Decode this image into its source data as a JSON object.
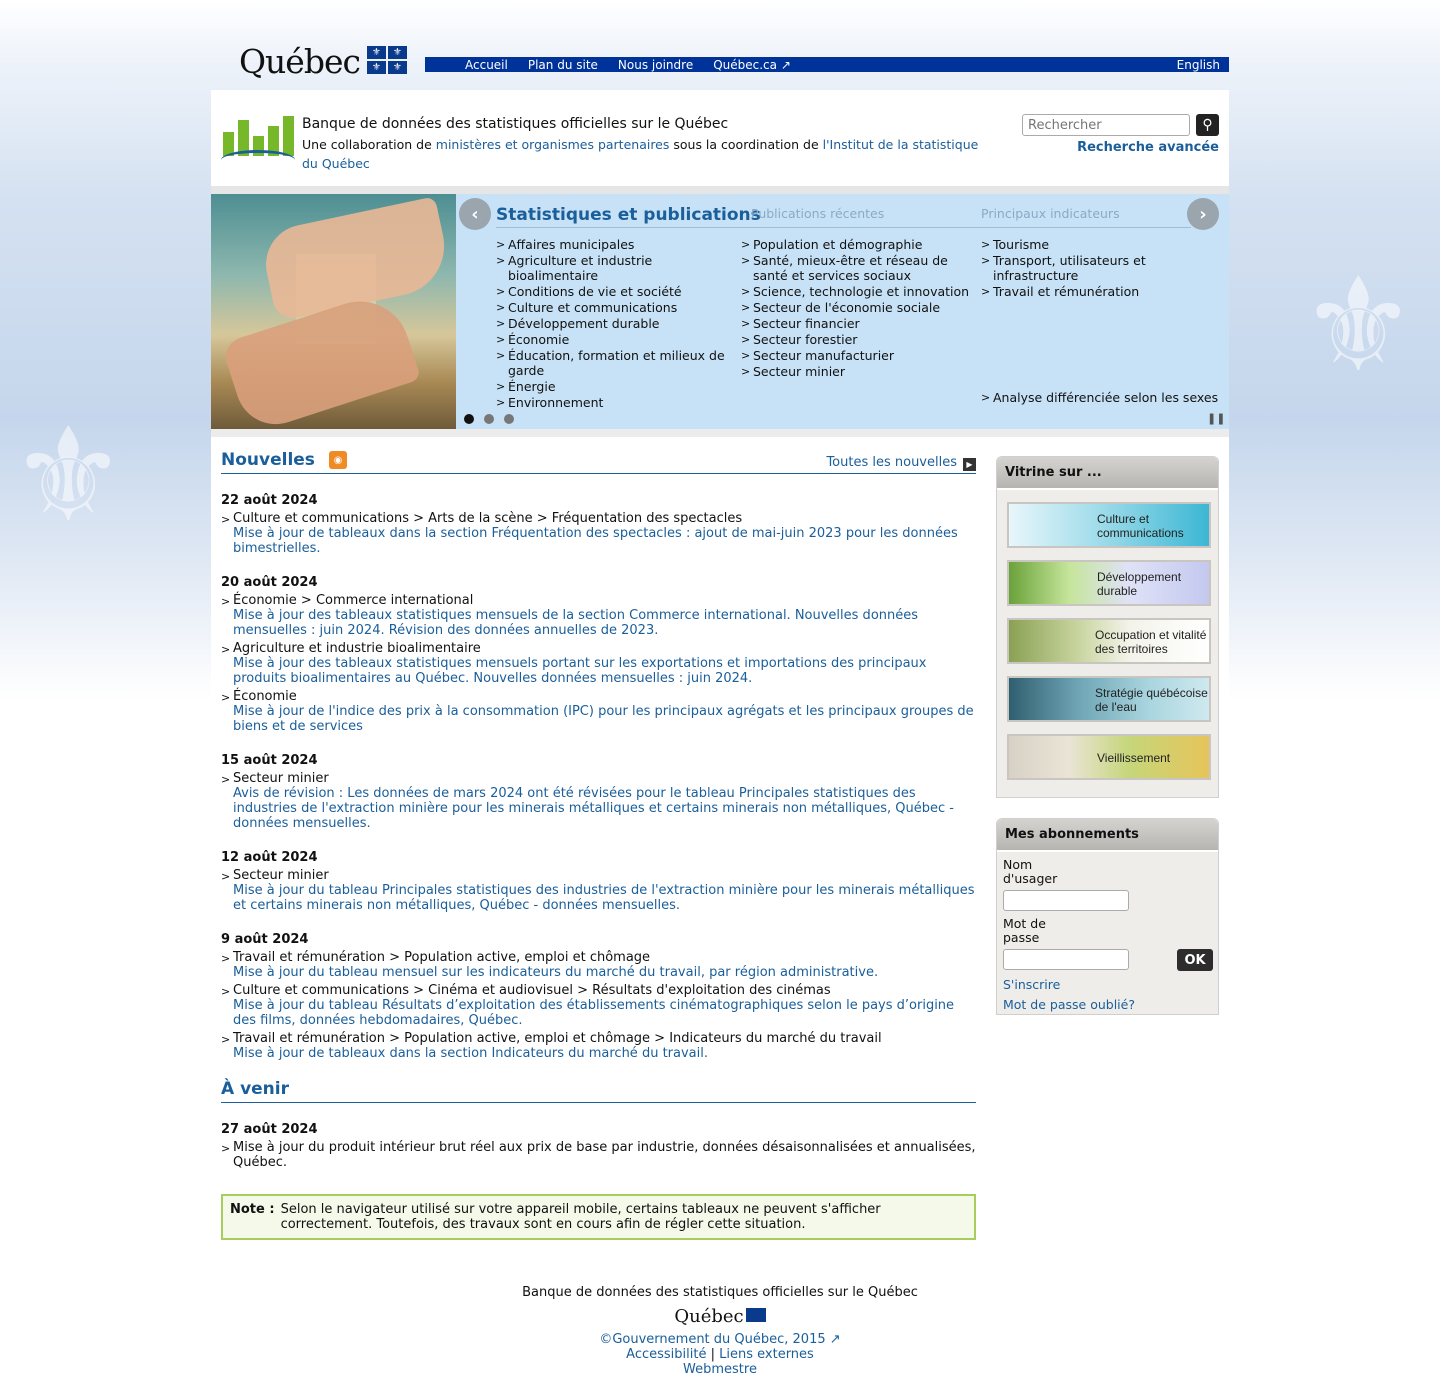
{
  "banner": {
    "logo_text": "Québec",
    "nav": [
      "Accueil",
      "Plan du site",
      "Nous joindre",
      "Québec.ca ↗"
    ],
    "english": "English"
  },
  "header": {
    "title": "Banque de données des statistiques officielles sur le Québec",
    "sub_pre": "Une collaboration de ",
    "sub_link1": "ministères et organismes partenaires",
    "sub_mid": " sous la coordination de ",
    "sub_link2": "l'Institut de la statistique du Québec",
    "search_placeholder": "Rechercher",
    "advanced_search": "Recherche avancée"
  },
  "carousel": {
    "active_tab": "Statistiques et publications",
    "tab2": "Publications récentes",
    "tab3": "Principaux indicateurs",
    "col1": [
      "Affaires municipales",
      "Agriculture et industrie bioalimentaire",
      "Conditions de vie et société",
      "Culture et communications",
      "Développement durable",
      "Économie",
      "Éducation, formation et milieux de garde",
      "Énergie",
      "Environnement"
    ],
    "col2": [
      "Population et démographie",
      "Santé, mieux-être et réseau de santé et services sociaux",
      "Science, technologie et innovation",
      "Secteur de l'économie sociale",
      "Secteur financier",
      "Secteur forestier",
      "Secteur manufacturier",
      "Secteur minier"
    ],
    "col3": [
      "Tourisme",
      "Transport, utilisateurs et infrastructure",
      "Travail et rémunération"
    ],
    "extra": "Analyse différenciée selon les sexes"
  },
  "news": {
    "title": "Nouvelles",
    "all_link": "Toutes les nouvelles",
    "groups": [
      {
        "date": "22 août 2024",
        "items": [
          {
            "path": "Culture et communications > Arts de la scène > Fréquentation des spectacles",
            "desc": "Mise à jour de tableaux dans la section Fréquentation des spectacles : ajout de mai-juin 2023 pour les données bimestrielles."
          }
        ]
      },
      {
        "date": "20 août 2024",
        "items": [
          {
            "path": "Économie > Commerce international",
            "desc": "Mise à jour des tableaux statistiques mensuels de la section Commerce international. Nouvelles données mensuelles : juin 2024. Révision des données annuelles de 2023."
          },
          {
            "path": "Agriculture et industrie bioalimentaire",
            "desc": "Mise à jour des tableaux statistiques mensuels portant sur les exportations et importations des principaux produits bioalimentaires au Québec. Nouvelles données mensuelles : juin 2024."
          },
          {
            "path": "Économie",
            "desc": "Mise à jour de l'indice des prix à la consommation (IPC) pour les principaux agrégats et les principaux groupes de biens et de services"
          }
        ]
      },
      {
        "date": "15 août 2024",
        "items": [
          {
            "path": "Secteur minier",
            "desc": "Avis de révision : Les données de mars 2024 ont été révisées pour le tableau Principales statistiques des industries de l'extraction minière pour les minerais métalliques et certains minerais non métalliques, Québec - données mensuelles."
          }
        ]
      },
      {
        "date": "12 août 2024",
        "items": [
          {
            "path": "Secteur minier",
            "desc": "Mise à jour du tableau Principales statistiques des industries de l'extraction minière pour les minerais métalliques et certains minerais non métalliques, Québec - données mensuelles."
          }
        ]
      },
      {
        "date": "9 août 2024",
        "items": [
          {
            "path": "Travail et rémunération > Population active, emploi et chômage",
            "desc": "Mise à jour du tableau mensuel sur les indicateurs du marché du travail, par région administrative."
          },
          {
            "path": "Culture et communications > Cinéma et audiovisuel > Résultats d'exploitation des cinémas",
            "desc": "Mise à jour du tableau Résultats d’exploitation des établissements cinématographiques selon le pays d’origine des films, données hebdomadaires, Québec."
          },
          {
            "path": "Travail et rémunération > Population active, emploi et chômage > Indicateurs du marché du travail",
            "desc": "Mise à jour de tableaux dans la section Indicateurs du marché du travail."
          }
        ]
      }
    ]
  },
  "upcoming": {
    "title": "À venir",
    "date": "27 août 2024",
    "item": "Mise à jour du produit intérieur brut réel aux prix de base par industrie, données désaisonnalisées et annualisées, Québec."
  },
  "note": {
    "label": "Note :",
    "text": "Selon le navigateur utilisé sur votre appareil mobile, certains tableaux ne peuvent s'afficher correctement. Toutefois, des travaux sont en cours afin de régler cette situation."
  },
  "vitrine": {
    "title": "Vitrine sur ...",
    "items": [
      "Culture et communications",
      "Développement durable",
      "Occupation et vitalité des territoires",
      "Stratégie québécoise de l'eau",
      "Vieillissement"
    ]
  },
  "login": {
    "title": "Mes abonnements",
    "user_label": "Nom d'usager",
    "pass_label": "Mot de passe",
    "ok": "OK",
    "signup": "S'inscrire",
    "forgot": "Mot de passe oublié?"
  },
  "footer": {
    "title": "Banque de données des statistiques officielles sur le Québec",
    "logo_text": "Québec",
    "copyright": "©Gouvernement du Québec, 2015 ↗",
    "accessibility": "Accessibilité",
    "sep": " | ",
    "external": "Liens externes",
    "webmaster": "Webmestre"
  }
}
